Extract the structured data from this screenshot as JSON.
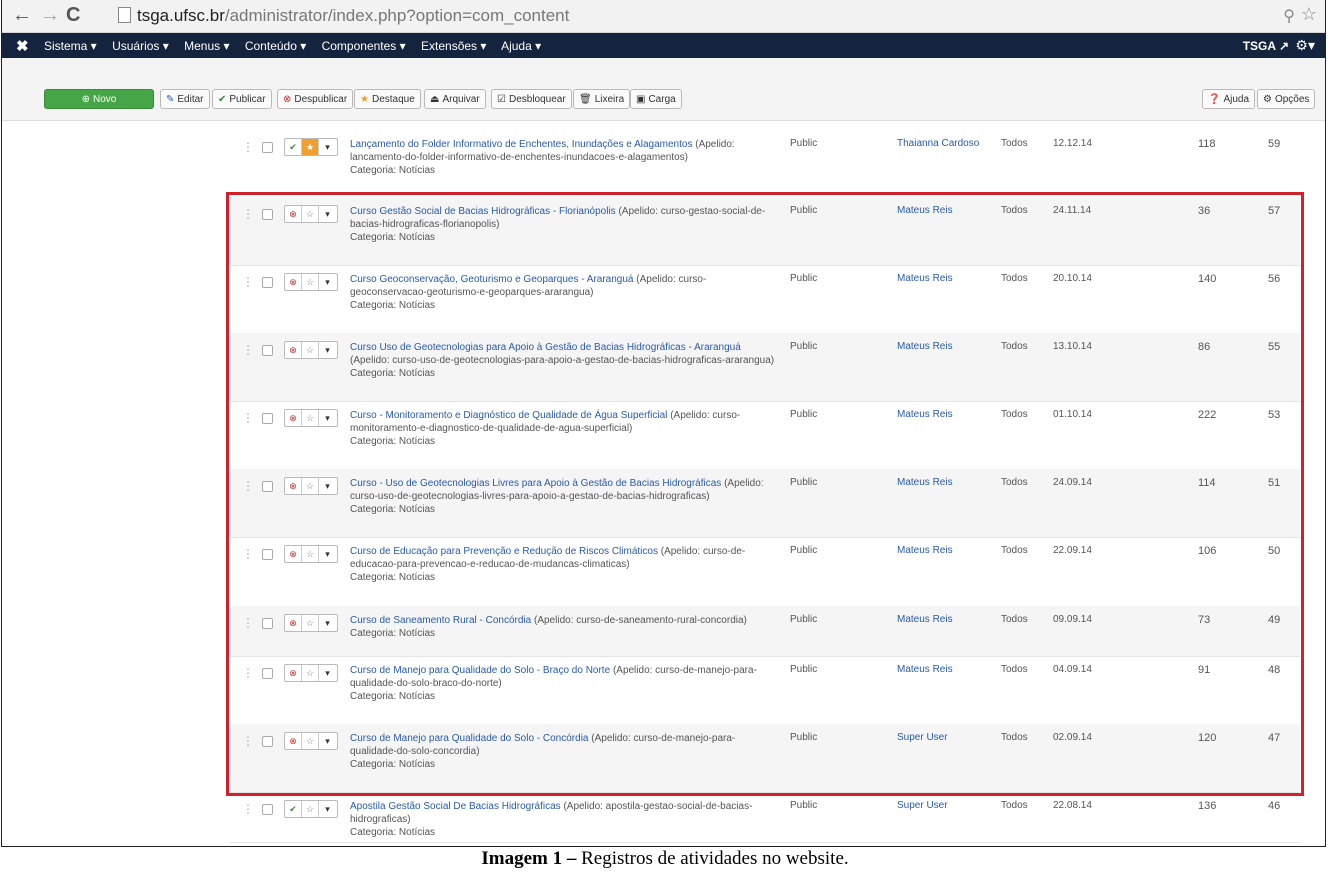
{
  "browser": {
    "url_host": "tsga.ufsc.br",
    "url_path": "/administrator/index.php?option=com_content"
  },
  "admin_nav": {
    "menu": [
      "Sistema ▾",
      "Usuários ▾",
      "Menus ▾",
      "Conteúdo ▾",
      "Componentes ▾",
      "Extensões ▾",
      "Ajuda ▾"
    ],
    "site_name": "TSGA",
    "colors": {
      "bar": "#15243e"
    }
  },
  "toolbar": {
    "new": "Novo",
    "edit": "Editar",
    "publish": "Publicar",
    "unpublish": "Despublicar",
    "feature": "Destaque",
    "archive": "Arquivar",
    "checkin": "Desbloquear",
    "trash": "Lixeira",
    "batch": "Carga",
    "help": "Ajuda",
    "options": "Opções"
  },
  "articles": [
    {
      "title": "Lançamento do Folder Informativo de Enchentes, Inundações e Alagamentos",
      "alias": "(Apelido: lancamento-do-folder-informativo-de-enchentes-inundacoes-e-alagamentos)",
      "category": "Categoria: Notícias",
      "published": true,
      "featured": true,
      "access": "Public",
      "author": "Thaianna Cardoso",
      "language": "Todos",
      "date": "12.12.14",
      "hits": "118",
      "id": "59"
    },
    {
      "title": "Curso Gestão Social de Bacias Hidrográficas - Florianópolis",
      "alias": "(Apelido: curso-gestao-social-de-bacias-hidrograficas-florianopolis)",
      "category": "Categoria: Notícias",
      "published": false,
      "featured": false,
      "access": "Public",
      "author": "Mateus Reis",
      "language": "Todos",
      "date": "24.11.14",
      "hits": "36",
      "id": "57"
    },
    {
      "title": "Curso Geoconservação, Geoturismo e Geoparques - Araranguá",
      "alias": "(Apelido: curso-geoconservacao-geoturismo-e-geoparques-ararangua)",
      "category": "Categoria: Notícias",
      "published": false,
      "featured": false,
      "access": "Public",
      "author": "Mateus Reis",
      "language": "Todos",
      "date": "20.10.14",
      "hits": "140",
      "id": "56"
    },
    {
      "title": "Curso Uso de Geotecnologias para Apoio à Gestão de Bacias Hidrográficas - Araranguá",
      "alias": "(Apelido: curso-uso-de-geotecnologias-para-apoio-a-gestao-de-bacias-hidrograficas-ararangua)",
      "category": "Categoria: Notícias",
      "published": false,
      "featured": false,
      "access": "Public",
      "author": "Mateus Reis",
      "language": "Todos",
      "date": "13.10.14",
      "hits": "86",
      "id": "55"
    },
    {
      "title": "Curso - Monitoramento e Diagnóstico de Qualidade de Água Superficial",
      "alias": "(Apelido: curso-monitoramento-e-diagnostico-de-qualidade-de-agua-superficial)",
      "category": "Categoria: Notícias",
      "published": false,
      "featured": false,
      "access": "Public",
      "author": "Mateus Reis",
      "language": "Todos",
      "date": "01.10.14",
      "hits": "222",
      "id": "53"
    },
    {
      "title": "Curso - Uso de Geotecnologias Livres para Apoio à Gestão de Bacias Hidrográficas",
      "alias": "(Apelido: curso-uso-de-geotecnologias-livres-para-apoio-a-gestao-de-bacias-hidrograficas)",
      "category": "Categoria: Notícias",
      "published": false,
      "featured": false,
      "access": "Public",
      "author": "Mateus Reis",
      "language": "Todos",
      "date": "24.09.14",
      "hits": "114",
      "id": "51"
    },
    {
      "title": "Curso de Educação para Prevenção e Redução de Riscos Climáticos",
      "alias": "(Apelido: curso-de-educacao-para-prevencao-e-reducao-de-mudancas-climaticas)",
      "category": "Categoria: Notícias",
      "published": false,
      "featured": false,
      "access": "Public",
      "author": "Mateus Reis",
      "language": "Todos",
      "date": "22.09.14",
      "hits": "106",
      "id": "50"
    },
    {
      "title": "Curso de Saneamento Rural - Concórdia",
      "alias": "(Apelido: curso-de-saneamento-rural-concordia)",
      "category": "Categoria: Notícias",
      "published": false,
      "featured": false,
      "access": "Public",
      "author": "Mateus Reis",
      "language": "Todos",
      "date": "09.09.14",
      "hits": "73",
      "id": "49"
    },
    {
      "title": "Curso de Manejo para Qualidade do Solo - Braço do Norte",
      "alias": "(Apelido: curso-de-manejo-para-qualidade-do-solo-braco-do-norte)",
      "category": "Categoria: Notícias",
      "published": false,
      "featured": false,
      "access": "Public",
      "author": "Mateus Reis",
      "language": "Todos",
      "date": "04.09.14",
      "hits": "91",
      "id": "48"
    },
    {
      "title": "Curso de Manejo para Qualidade do Solo - Concórdia",
      "alias": "(Apelido: curso-de-manejo-para-qualidade-do-solo-concordia)",
      "category": "Categoria: Notícias",
      "published": false,
      "featured": false,
      "access": "Public",
      "author": "Super User",
      "language": "Todos",
      "date": "02.09.14",
      "hits": "120",
      "id": "47"
    },
    {
      "title": "Apostila Gestão Social De Bacias Hidrográficas",
      "alias": "(Apelido: apostila-gestao-social-de-bacias-hidrograficas)",
      "category": "Categoria: Notícias",
      "published": true,
      "featured": false,
      "access": "Public",
      "author": "Super User",
      "language": "Todos",
      "date": "22.08.14",
      "hits": "136",
      "id": "46"
    }
  ],
  "caption": {
    "label": "Imagem 1 –",
    "text": " Registros de atividades no website."
  }
}
